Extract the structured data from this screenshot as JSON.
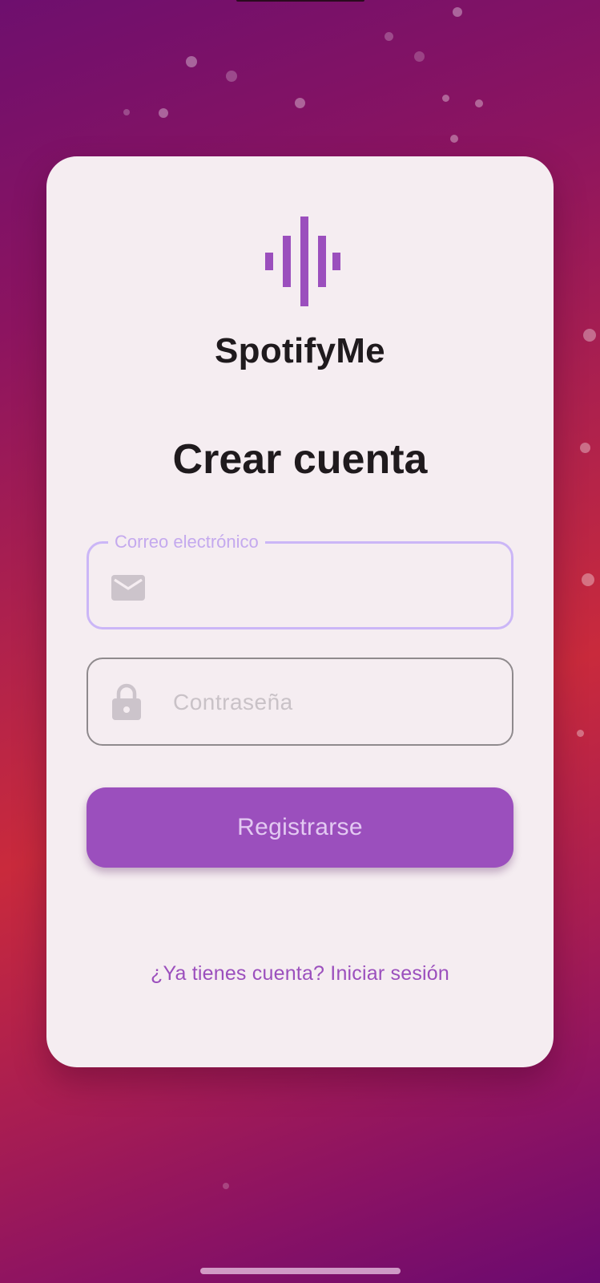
{
  "app": {
    "name": "SpotifyMe",
    "logo_icon": "sound-wave-icon",
    "accent_color": "#9b4fbd"
  },
  "form": {
    "title": "Crear cuenta",
    "email": {
      "label": "Correo electrónico",
      "icon": "mail-icon",
      "value": ""
    },
    "password": {
      "placeholder": "Contraseña",
      "icon": "lock-icon"
    },
    "submit_label": "Registrarse",
    "login_link": "¿Ya tienes cuenta? Iniciar sesión"
  }
}
